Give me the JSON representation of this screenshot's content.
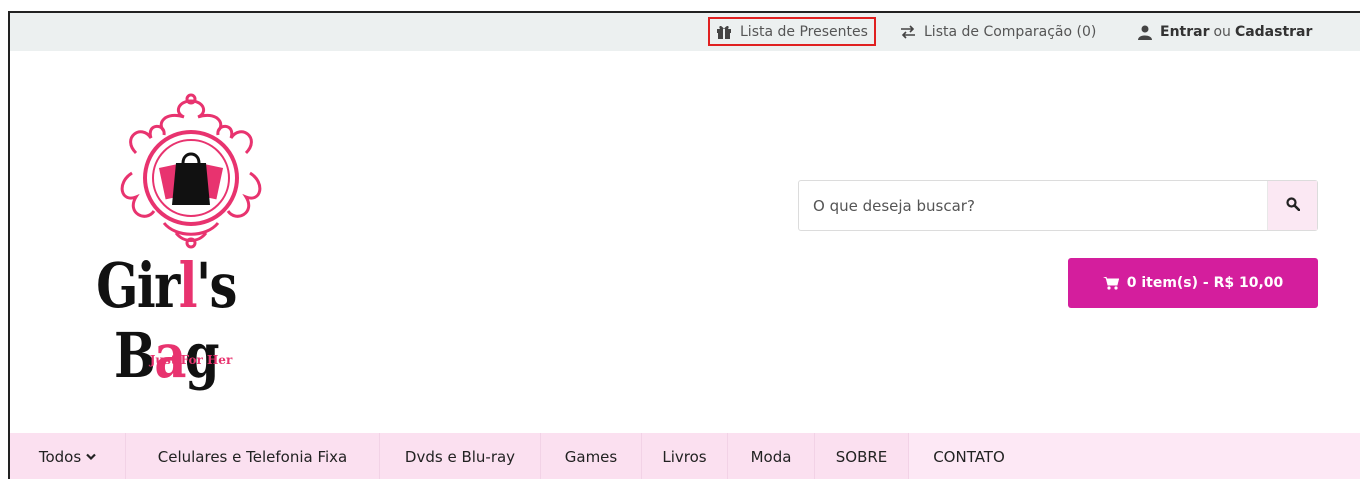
{
  "topbar": {
    "gift_list": {
      "label": "Lista de Presentes",
      "icon": "gift-icon"
    },
    "compare": {
      "label": "Lista de Comparação (0)",
      "icon": "swap-arrows-icon"
    },
    "account": {
      "icon": "user-icon",
      "login": "Entrar",
      "or": "ou",
      "register": "Cadastrar"
    }
  },
  "logo": {
    "word_part1": "Gir",
    "word_pink_l": "l",
    "word_apos": "'s B",
    "word_pink_a": "a",
    "word_end": "g",
    "tagline": "Just For Her"
  },
  "search": {
    "placeholder": "O que deseja buscar?",
    "icon": "search-icon"
  },
  "cart": {
    "label": "0 item(s) - R$ 10,00",
    "icon": "cart-icon"
  },
  "nav": {
    "items": [
      {
        "label": "Todos"
      },
      {
        "label": "Celulares e Telefonia Fixa"
      },
      {
        "label": "Dvds e Blu-ray"
      },
      {
        "label": "Games"
      },
      {
        "label": "Livros"
      },
      {
        "label": "Moda"
      },
      {
        "label": "SOBRE"
      },
      {
        "label": "CONTATO"
      }
    ]
  },
  "colors": {
    "accent": "#d41e9d",
    "logo_pink": "#e8336f",
    "topbar_bg": "#ecf0f0",
    "nav_bg": "#fde8f5",
    "highlight_border": "#e02020"
  }
}
